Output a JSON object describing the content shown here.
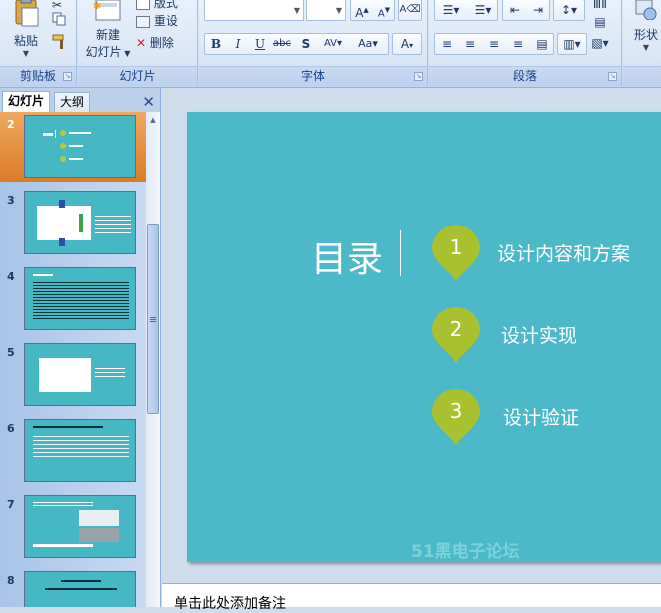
{
  "ribbon": {
    "clipboard": {
      "label": "剪贴板",
      "paste_label": "粘贴"
    },
    "slides": {
      "label": "幻灯片",
      "new_slide_label_1": "新建",
      "new_slide_label_2": "幻灯片",
      "layout_label": "版式",
      "reset_label": "重设",
      "delete_label": "删除"
    },
    "font": {
      "label": "字体",
      "font_name": "",
      "font_size": ""
    },
    "paragraph": {
      "label": "段落"
    },
    "drawing": {
      "shapes_label": "形状"
    }
  },
  "pane": {
    "tabs": [
      "幻灯片",
      "大纲"
    ],
    "active_tab": "幻灯片",
    "thumbnails": [
      {
        "number": "2",
        "selected": true
      },
      {
        "number": "3",
        "selected": false
      },
      {
        "number": "4",
        "selected": false
      },
      {
        "number": "5",
        "selected": false
      },
      {
        "number": "6",
        "selected": false
      },
      {
        "number": "7",
        "selected": false
      },
      {
        "number": "8",
        "selected": false
      }
    ]
  },
  "slide": {
    "title": "目录",
    "items": [
      {
        "number": "1",
        "label": "设计内容和方案"
      },
      {
        "number": "2",
        "label": "设计实现"
      },
      {
        "number": "3",
        "label": "设计验证"
      }
    ],
    "background_color": "#4bb9c7",
    "pin_color": "#a9c02f",
    "watermark": "51黑电子论坛"
  },
  "notes": {
    "placeholder": "单击此处添加备注"
  }
}
